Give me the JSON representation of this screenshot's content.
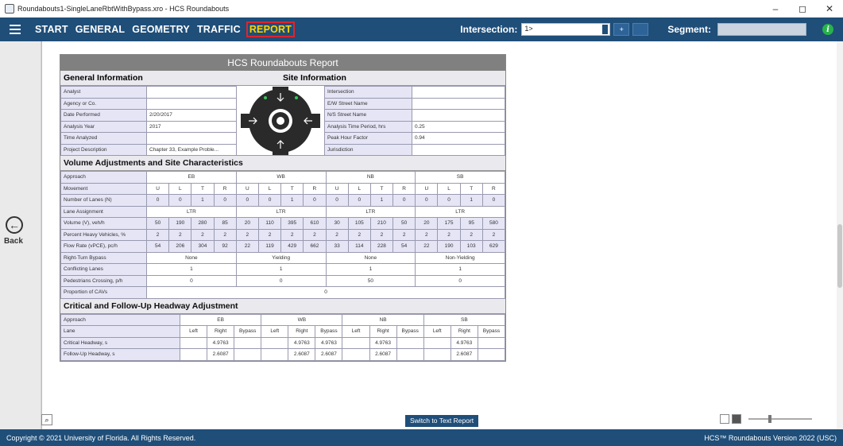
{
  "window": {
    "title": "Roundabouts1-SingleLaneRbtWithBypass.xro - HCS Roundabouts",
    "minimize": "–",
    "maximize": "◻",
    "close": "✕"
  },
  "menu": {
    "items": [
      "START",
      "GENERAL",
      "GEOMETRY",
      "TRAFFIC",
      "REPORT"
    ],
    "active": "REPORT",
    "intersection_label": "Intersection:",
    "intersection_value": "1>",
    "prev_btn": "+",
    "next_btn": "",
    "segment_label": "Segment:",
    "segment_value": "",
    "info_glyph": "i"
  },
  "left": {
    "back_label": "Back",
    "back_glyph": "←"
  },
  "report": {
    "title": "HCS Roundabouts Report",
    "general_header": "General Information",
    "site_header": "Site Information",
    "general_rows": [
      {
        "label": "Analyst",
        "value": ""
      },
      {
        "label": "Agency or Co.",
        "value": ""
      },
      {
        "label": "Date Performed",
        "value": "2/20/2017"
      },
      {
        "label": "Analysis Year",
        "value": "2017"
      },
      {
        "label": "Time Analyzed",
        "value": ""
      },
      {
        "label": "Project Description",
        "value": "Chapter 33, Example Proble..."
      }
    ],
    "site_rows": [
      {
        "label": "Intersection",
        "value": ""
      },
      {
        "label": "E/W Street Name",
        "value": ""
      },
      {
        "label": "N/S Street Name",
        "value": ""
      },
      {
        "label": "Analysis Time Period, hrs",
        "value": "0.25"
      },
      {
        "label": "Peak Hour Factor",
        "value": "0.94"
      },
      {
        "label": "Jurisdiction",
        "value": ""
      }
    ],
    "volume_header": "Volume Adjustments and Site Characteristics",
    "volume": {
      "approach_label": "Approach",
      "approaches": [
        "EB",
        "WB",
        "NB",
        "SB"
      ],
      "movement_label": "Movement",
      "movements": [
        "U",
        "L",
        "T",
        "R"
      ],
      "rows": [
        {
          "label": "Number of Lanes (N)",
          "cells": [
            "0",
            "0",
            "1",
            "0",
            "0",
            "0",
            "1",
            "0",
            "0",
            "0",
            "1",
            "0",
            "0",
            "0",
            "1",
            "0"
          ]
        },
        {
          "label": "Volume (V), veh/h",
          "cells": [
            "50",
            "190",
            "280",
            "85",
            "20",
            "110",
            "395",
            "610",
            "30",
            "105",
            "210",
            "50",
            "20",
            "175",
            "95",
            "580"
          ]
        },
        {
          "label": "Percent Heavy Vehicles, %",
          "cells": [
            "2",
            "2",
            "2",
            "2",
            "2",
            "2",
            "2",
            "2",
            "2",
            "2",
            "2",
            "2",
            "2",
            "2",
            "2",
            "2"
          ]
        },
        {
          "label": "Flow Rate (vPCE), pc/h",
          "cells": [
            "54",
            "206",
            "304",
            "92",
            "22",
            "119",
            "429",
            "662",
            "33",
            "114",
            "228",
            "54",
            "22",
            "190",
            "103",
            "629"
          ]
        }
      ],
      "lane_assignment_label": "Lane Assignment",
      "lane_assignment": [
        "LTR",
        "LTR",
        "LTR",
        "LTR"
      ],
      "bypass_label": "Right-Turn Bypass",
      "bypass": [
        "None",
        "Yielding",
        "None",
        "Non-Yielding"
      ],
      "conflicting_label": "Conflicting Lanes",
      "conflicting": [
        "1",
        "1",
        "1",
        "1"
      ],
      "ped_label": "Pedestrians Crossing, p/h",
      "ped": [
        "0",
        "0",
        "50",
        "0"
      ],
      "cav_label": "Proportion of CAVs",
      "cav": "0"
    },
    "headway_header": "Critical and Follow-Up Headway Adjustment",
    "headway": {
      "approach_label": "Approach",
      "approaches": [
        "EB",
        "WB",
        "NB",
        "SB"
      ],
      "lane_label": "Lane",
      "lanes": [
        "Left",
        "Right",
        "Bypass"
      ],
      "rows": [
        {
          "label": "Critical Headway, s",
          "cells": [
            "",
            "4.9763",
            "",
            "",
            "4.9763",
            "4.9763",
            "",
            "4.9763",
            "",
            "",
            "4.9763",
            ""
          ]
        },
        {
          "label": "Follow-Up Headway, s",
          "cells": [
            "",
            "2.6087",
            "",
            "",
            "2.6087",
            "2.6087",
            "",
            "2.6087",
            "",
            "",
            "2.6087",
            ""
          ]
        }
      ]
    }
  },
  "bottom": {
    "switch_label": "Switch to Text Report",
    "zoom_glyph": "⌕",
    "zoom_level": 0.33
  },
  "status": {
    "copyright": "Copyright © 2021 University of Florida. All Rights Reserved.",
    "version": "HCS™ Roundabouts Version 2022 (USC)"
  },
  "colors": {
    "menu_bg": "#1f4e79",
    "active_menu": "#ffd400",
    "active_border": "#e0242b",
    "label_cell": "#e5e5f6"
  }
}
